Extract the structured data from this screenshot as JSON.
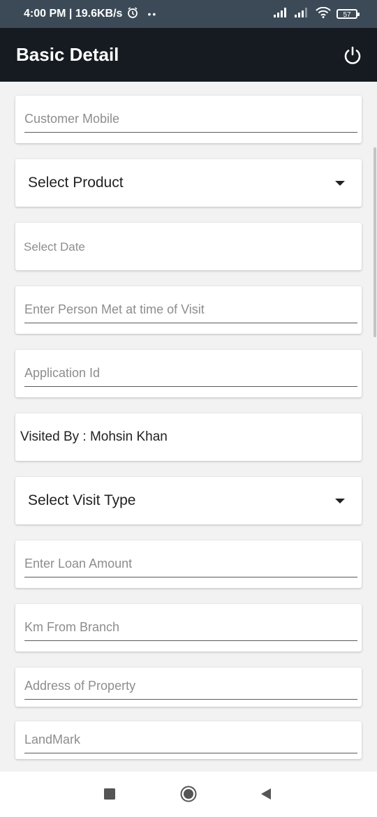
{
  "status_bar": {
    "time_speed": "4:00 PM | 19.6KB/s",
    "dots": "••",
    "battery": "57",
    "icons": [
      "alarm-icon",
      "signal-icon",
      "signal-icon",
      "wifi-icon",
      "battery-icon"
    ]
  },
  "app_bar": {
    "title": "Basic Detail",
    "power_icon": "power-icon"
  },
  "form": {
    "customer_mobile_placeholder": "Customer Mobile",
    "select_product_label": "Select Product",
    "select_date_placeholder": "Select Date",
    "person_met_placeholder": "Enter Person Met at time of Visit",
    "application_id_placeholder": "Application Id",
    "visited_by": "Visited By : Mohsin Khan",
    "select_visit_type_label": "Select Visit Type",
    "loan_amount_placeholder": "Enter Loan Amount",
    "km_from_branch_placeholder": "Km From Branch",
    "address_placeholder": "Address of Property",
    "landmark_placeholder": "LandMark"
  },
  "nav_bar": {
    "icons": [
      "recents-icon",
      "home-icon",
      "back-icon"
    ]
  },
  "colors": {
    "status_bar": "#3c4a57",
    "app_bar": "#151b20",
    "background": "#f2f2f2"
  }
}
